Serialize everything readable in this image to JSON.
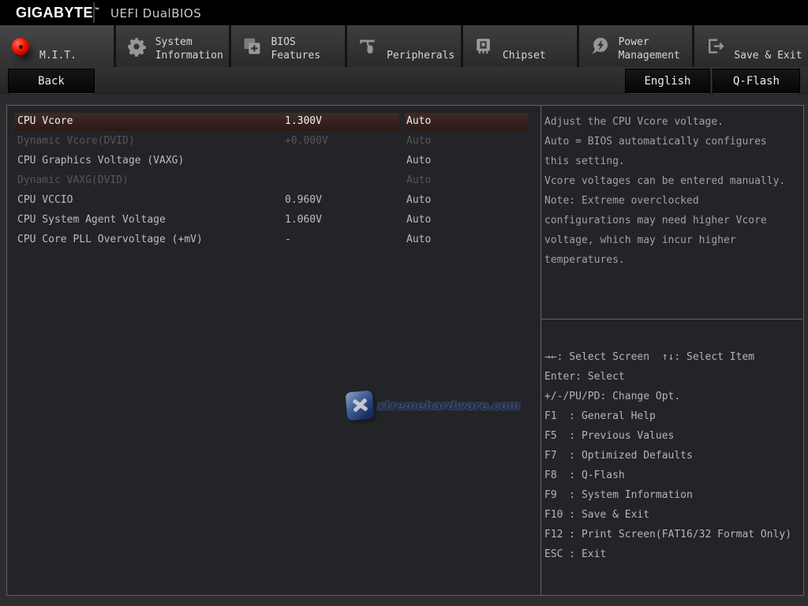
{
  "topbar": {
    "brand": "GIGABYTE",
    "trademark": "™",
    "title": "UEFI DualBIOS"
  },
  "tabbar": {
    "tabs": [
      {
        "name": "mit",
        "line1": "M.I.T.",
        "line2": "",
        "icon": "red-ball-icon",
        "active": true
      },
      {
        "name": "system-information",
        "line1": "System",
        "line2": "Information",
        "icon": "gear-icon",
        "active": false
      },
      {
        "name": "bios-features",
        "line1": "BIOS",
        "line2": "Features",
        "icon": "bios-icon",
        "active": false
      },
      {
        "name": "peripherals",
        "line1": "Peripherals",
        "line2": "",
        "icon": "mouse-icon",
        "active": false
      },
      {
        "name": "chipset",
        "line1": "Chipset",
        "line2": "",
        "icon": "chip-icon",
        "active": false
      },
      {
        "name": "power-management",
        "line1": "Power",
        "line2": "Management",
        "icon": "power-icon",
        "active": false
      },
      {
        "name": "save-exit",
        "line1": "Save & Exit",
        "line2": "",
        "icon": "exit-icon",
        "active": false
      }
    ]
  },
  "subbar": {
    "back_label": "Back",
    "english_label": "English",
    "qflash_label": "Q-Flash"
  },
  "settings": {
    "rows": [
      {
        "label": "CPU Vcore",
        "value": "1.300V",
        "option": "Auto",
        "selected": true,
        "disabled": false
      },
      {
        "label": "Dynamic Vcore(DVID)",
        "value": "+0.000V",
        "option": "Auto",
        "selected": false,
        "disabled": true
      },
      {
        "label": "CPU Graphics Voltage (VAXG)",
        "value": "",
        "option": "Auto",
        "selected": false,
        "disabled": false
      },
      {
        "label": "Dynamic VAXG(DVID)",
        "value": "",
        "option": "Auto",
        "selected": false,
        "disabled": true
      },
      {
        "label": "CPU VCCIO",
        "value": "0.960V",
        "option": "Auto",
        "selected": false,
        "disabled": false
      },
      {
        "label": "CPU System Agent Voltage",
        "value": "1.060V",
        "option": "Auto",
        "selected": false,
        "disabled": false
      },
      {
        "label": "CPU Core PLL Overvoltage (+mV)",
        "value": "-",
        "option": "Auto",
        "selected": false,
        "disabled": false
      }
    ]
  },
  "help": {
    "lines": [
      "Adjust the CPU Vcore voltage.",
      "Auto = BIOS automatically configures",
      "this setting.",
      "Vcore voltages can be entered manually.",
      "Note: Extreme overclocked",
      "configurations may need higher Vcore",
      "voltage, which may incur higher",
      "temperatures."
    ]
  },
  "shortcuts": {
    "lines": [
      "→←: Select Screen  ↑↓: Select Item",
      "Enter: Select",
      "+/-/PU/PD: Change Opt.",
      "F1  : General Help",
      "F5  : Previous Values",
      "F7  : Optimized Defaults",
      "F8  : Q-Flash",
      "F9  : System Information",
      "F10 : Save & Exit",
      "F12 : Print Screen(FAT16/32 Format Only)",
      "ESC : Exit"
    ]
  },
  "watermark": {
    "text": "xtremehardware.com"
  },
  "colors": {
    "accent_red": "#e00000",
    "row_highlight": "#3c2620",
    "panel_border": "#606265",
    "panel_bg": "#232427",
    "icon_gray": "#969696"
  }
}
